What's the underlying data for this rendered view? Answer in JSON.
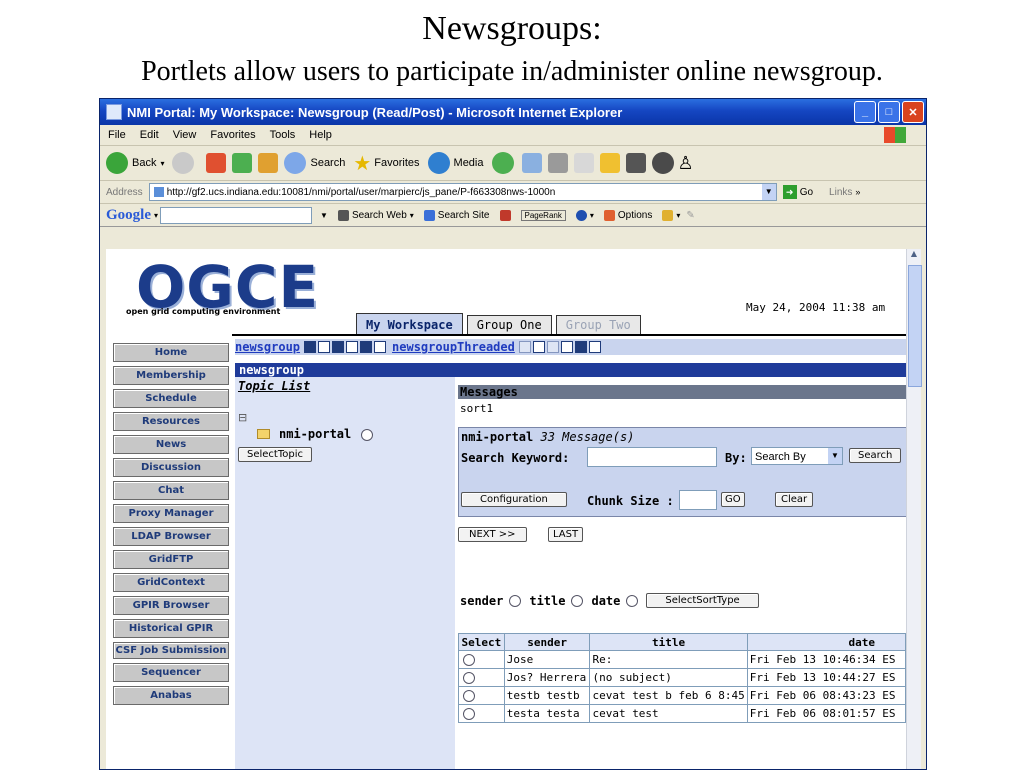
{
  "slide": {
    "title": "Newsgroups:",
    "subtitle": "Portlets allow users to participate in/administer online newsgroup."
  },
  "browser": {
    "window_title": "NMI Portal: My Workspace: Newsgroup (Read/Post) - Microsoft Internet Explorer",
    "menu": [
      "File",
      "Edit",
      "View",
      "Favorites",
      "Tools",
      "Help"
    ],
    "toolbar": {
      "back": "Back",
      "search": "Search",
      "favorites": "Favorites",
      "media": "Media"
    },
    "address_label": "Address",
    "url": "http://gf2.ucs.indiana.edu:10081/nmi/portal/user/marpierc/js_pane/P-f663308nws-1000n",
    "go": "Go",
    "links": "Links",
    "google": {
      "logo": "Google",
      "search_web": "Search Web",
      "search_site": "Search Site",
      "pagerank": "PageRank",
      "options": "Options"
    }
  },
  "portal": {
    "logo": "OGCE",
    "logo_sub": "open grid computing environment",
    "datetime": "May 24, 2004 11:38 am",
    "tabs": [
      "My Workspace",
      "Group One",
      "Group Two"
    ],
    "nav": [
      "Home",
      "Membership",
      "Schedule",
      "Resources",
      "News",
      "Discussion",
      "Chat",
      "Proxy Manager",
      "LDAP Browser",
      "GridFTP",
      "GridContext",
      "GPIR Browser",
      "Historical GPIR",
      "CSF Job Submission",
      "Sequencer",
      "Anabas"
    ],
    "portlet_links": {
      "newsgroup": "newsgroup",
      "threaded": "newsgroupThreaded"
    },
    "portlet_title": "newsgroup"
  },
  "topics": {
    "label": "Topic List",
    "item": "nmi-portal",
    "select_button": "SelectTopic"
  },
  "messages": {
    "header": "Messages",
    "sort": "sort1",
    "group": "nmi-portal",
    "count": "33 Message(s)",
    "search_label": "Search Keyword:",
    "by_label": "By:",
    "by_value": "Search By",
    "search_button": "Search",
    "config_button": "Configuration",
    "chunk_label": "Chunk Size :",
    "go_button": "GO",
    "clear_button": "Clear",
    "next_button": "NEXT  >>",
    "last_button": "LAST",
    "sort_options": [
      "sender",
      "title",
      "date"
    ],
    "sort_button": "SelectSortType",
    "columns": [
      "Select",
      "sender",
      "title",
      "date"
    ],
    "rows": [
      {
        "sender": "Jose",
        "title": "Re:",
        "date": "Fri Feb 13 10:46:34 ES"
      },
      {
        "sender": "Jos? Herrera",
        "title": "(no subject)",
        "date": "Fri Feb 13 10:44:27 ES"
      },
      {
        "sender": "testb testb",
        "title": "cevat test b feb 6 8:45",
        "date": "Fri Feb 06 08:43:23 ES"
      },
      {
        "sender": "testa testa",
        "title": "cevat test",
        "date": "Fri Feb 06 08:01:57 ES"
      }
    ]
  }
}
